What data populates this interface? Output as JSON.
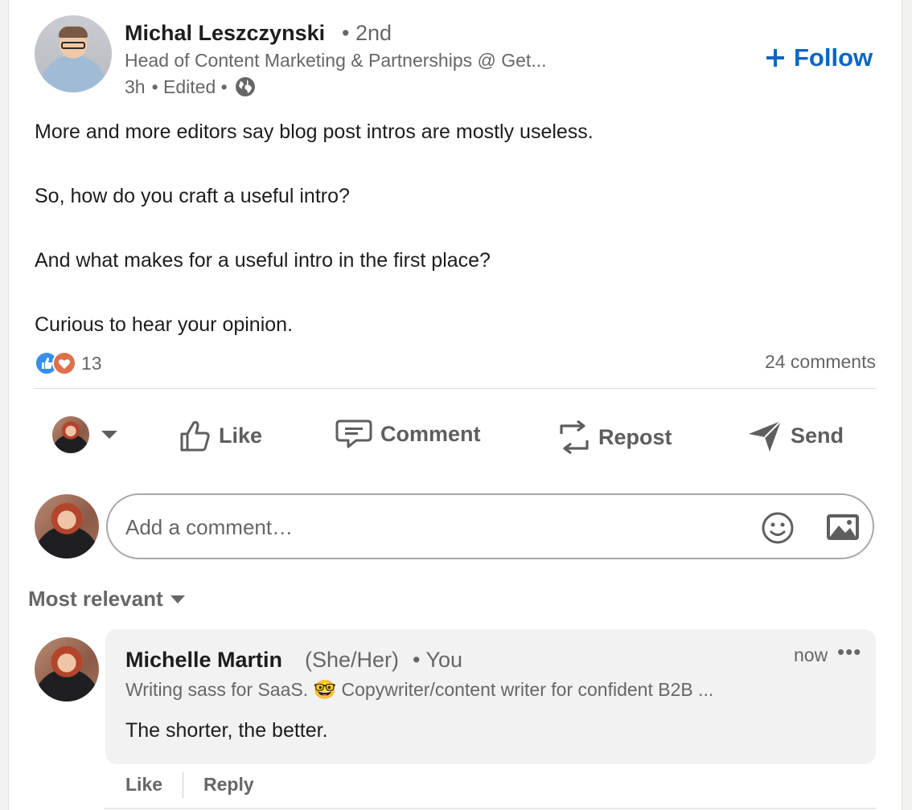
{
  "post": {
    "author": {
      "name": "Michal Leszczynski",
      "degree": "• 2nd",
      "headline": "Head of Content Marketing & Partnerships @ Get...",
      "time": "3h",
      "edited": "• Edited •",
      "visibility_icon": "globe-icon"
    },
    "follow_label": "Follow",
    "paragraphs": [
      "More and more editors say blog post intros are mostly useless.",
      "So, how do you craft a useful intro?",
      "And what makes for a useful intro in the first place?",
      "Curious to hear your opinion."
    ],
    "reaction_count": "13",
    "comments_count": "24 comments"
  },
  "actions": {
    "like": "Like",
    "comment": "Comment",
    "repost": "Repost",
    "send": "Send"
  },
  "comment_box": {
    "placeholder": "Add a comment…"
  },
  "sort": {
    "label": "Most relevant"
  },
  "comment": {
    "name": "Michelle Martin",
    "pronouns": "(She/Her)",
    "you": "• You",
    "time": "now",
    "more": "•••",
    "headline": "Writing sass for SaaS. 🤓 Copywriter/content writer for confident B2B ...",
    "text": "The shorter, the better.",
    "like": "Like",
    "reply": "Reply"
  },
  "colors": {
    "accent": "#0a66c2",
    "muted_text": "#666666",
    "bubble": "#f2f2f2"
  }
}
